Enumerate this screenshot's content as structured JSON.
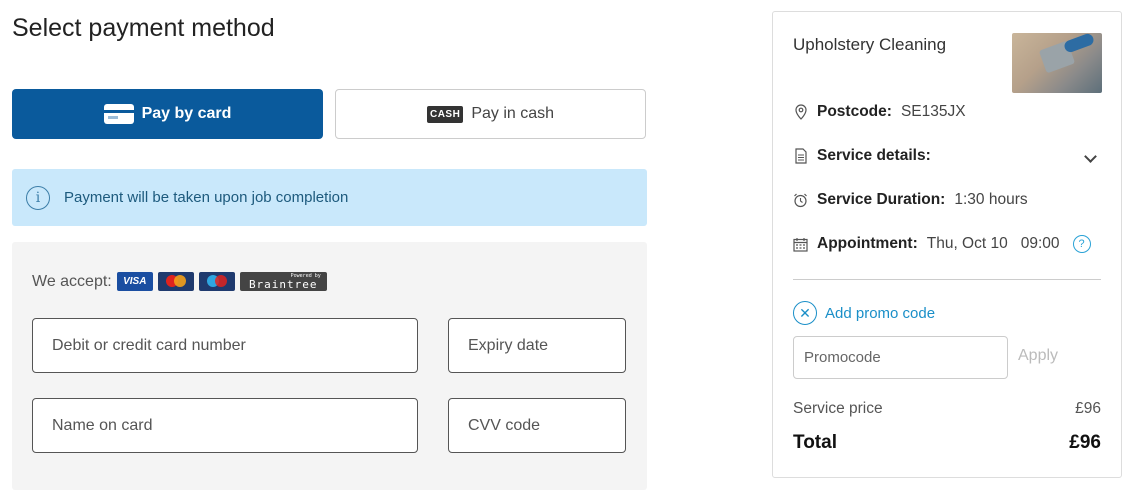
{
  "page": {
    "title": "Select payment method"
  },
  "payment_methods": {
    "card": {
      "label": "Pay by card",
      "icon": "credit-card-icon"
    },
    "cash": {
      "label": "Pay in cash",
      "badge": "CASH",
      "icon": "cash-icon"
    }
  },
  "info": {
    "icon": "info-icon",
    "text": "Payment will be taken upon job completion"
  },
  "card_form": {
    "accept_label": "We accept:",
    "brands": [
      "VISA",
      "mastercard",
      "maestro",
      "Braintree"
    ],
    "braintree_powered": "Powered by",
    "fields": {
      "card_number_placeholder": "Debit or credit card number",
      "expiry_placeholder": "Expiry date",
      "name_placeholder": "Name on card",
      "cvv_placeholder": "CVV code"
    }
  },
  "summary": {
    "service": "Upholstery Cleaning",
    "postcode_label": "Postcode:",
    "postcode": "SE135JX",
    "details_label": "Service details:",
    "duration_label": "Service Duration:",
    "duration": "1:30 hours",
    "appointment_label": "Appointment:",
    "appointment_date": "Thu, Oct 10",
    "appointment_time": "09:00",
    "promo_link": "Add promo code",
    "promo_placeholder": "Promocode",
    "apply_label": "Apply",
    "service_price_label": "Service price",
    "service_price": "£96",
    "total_label": "Total",
    "total": "£96"
  },
  "colors": {
    "primary": "#0a5a9c",
    "info_bg": "#c9e8fb",
    "link": "#1a8fc8"
  }
}
